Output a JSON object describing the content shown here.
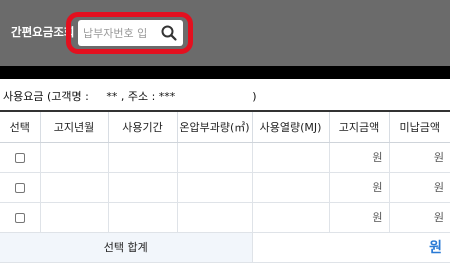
{
  "header": {
    "label": "간편요금조회",
    "search": {
      "placeholder": "납부자번호 입",
      "value": ""
    }
  },
  "usage_summary": {
    "prefix": "사용요금 (고객명 :",
    "name_masked": "** , 주소 : ***",
    "suffix": ")"
  },
  "table": {
    "columns": [
      "선택",
      "고지년월",
      "사용기간",
      "온압부과량(㎥)",
      "사용열량(MJ)",
      "고지금액",
      "미납금액"
    ],
    "rows": [
      {
        "billed": "원",
        "unpaid": "원"
      },
      {
        "billed": "원",
        "unpaid": "원"
      },
      {
        "billed": "원",
        "unpaid": "원"
      }
    ],
    "total": {
      "label": "선택 합계",
      "value": "원"
    }
  },
  "colors": {
    "highlight": "#e3101f",
    "header_bg": "#6b6b6b",
    "accent": "#2a7ad5"
  }
}
